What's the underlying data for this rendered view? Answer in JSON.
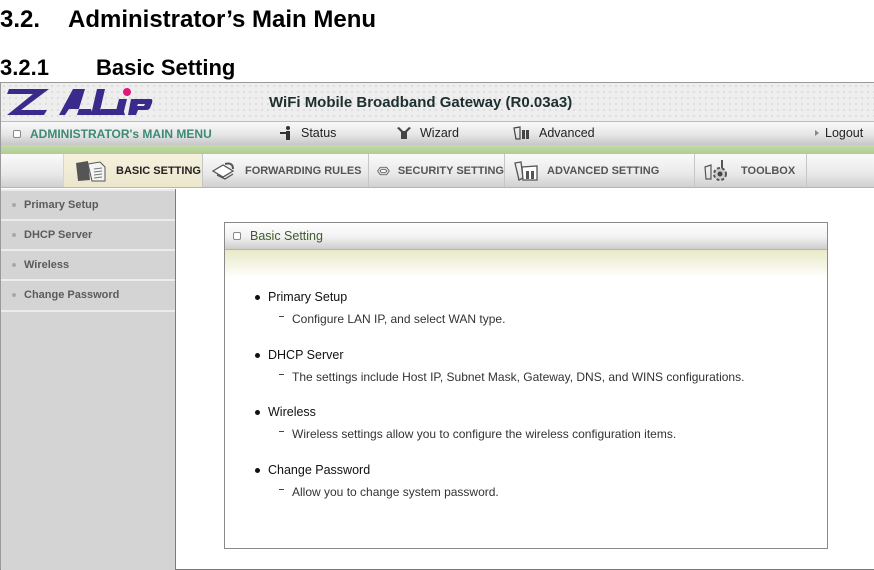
{
  "document": {
    "section_number": "3.2.",
    "section_title": "Administrator’s Main Menu",
    "subsection_number": "3.2.1",
    "subsection_title": "Basic Setting"
  },
  "header": {
    "logo_text": "ZALiP",
    "product_title": "WiFi Mobile Broadband Gateway (R0.03a3)",
    "brand_color": "#3a2a8c",
    "logo_dot_color": "#e0197a"
  },
  "main_menu": {
    "label": "ADMINISTRATOR's MAIN MENU",
    "items": [
      {
        "label": "Status",
        "icon": "status-icon"
      },
      {
        "label": "Wizard",
        "icon": "wizard-icon"
      },
      {
        "label": "Advanced",
        "icon": "advanced-icon"
      }
    ],
    "logout": "Logout"
  },
  "tabs": [
    {
      "label": "BASIC SETTING",
      "icon": "folder-icon",
      "active": true
    },
    {
      "label": "FORWARDING RULES",
      "icon": "forwarding-icon",
      "active": false
    },
    {
      "label": "SECURITY SETTING",
      "icon": "security-icon",
      "active": false
    },
    {
      "label": "ADVANCED SETTING",
      "icon": "advanced-setting-icon",
      "active": false
    },
    {
      "label": "TOOLBOX",
      "icon": "toolbox-icon",
      "active": false
    }
  ],
  "sidebar": {
    "items": [
      {
        "label": "Primary Setup"
      },
      {
        "label": "DHCP Server"
      },
      {
        "label": "Wireless"
      },
      {
        "label": "Change Password"
      }
    ]
  },
  "panel": {
    "title": "Basic Setting",
    "entries": [
      {
        "title": "Primary Setup",
        "description": "Configure LAN IP, and select WAN type."
      },
      {
        "title": "DHCP Server",
        "description": "The settings include Host IP, Subnet Mask, Gateway, DNS, and WINS configurations."
      },
      {
        "title": "Wireless",
        "description": "Wireless settings allow you to configure the wireless configuration items."
      },
      {
        "title": "Change Password",
        "description": "Allow you to change system password."
      }
    ]
  }
}
